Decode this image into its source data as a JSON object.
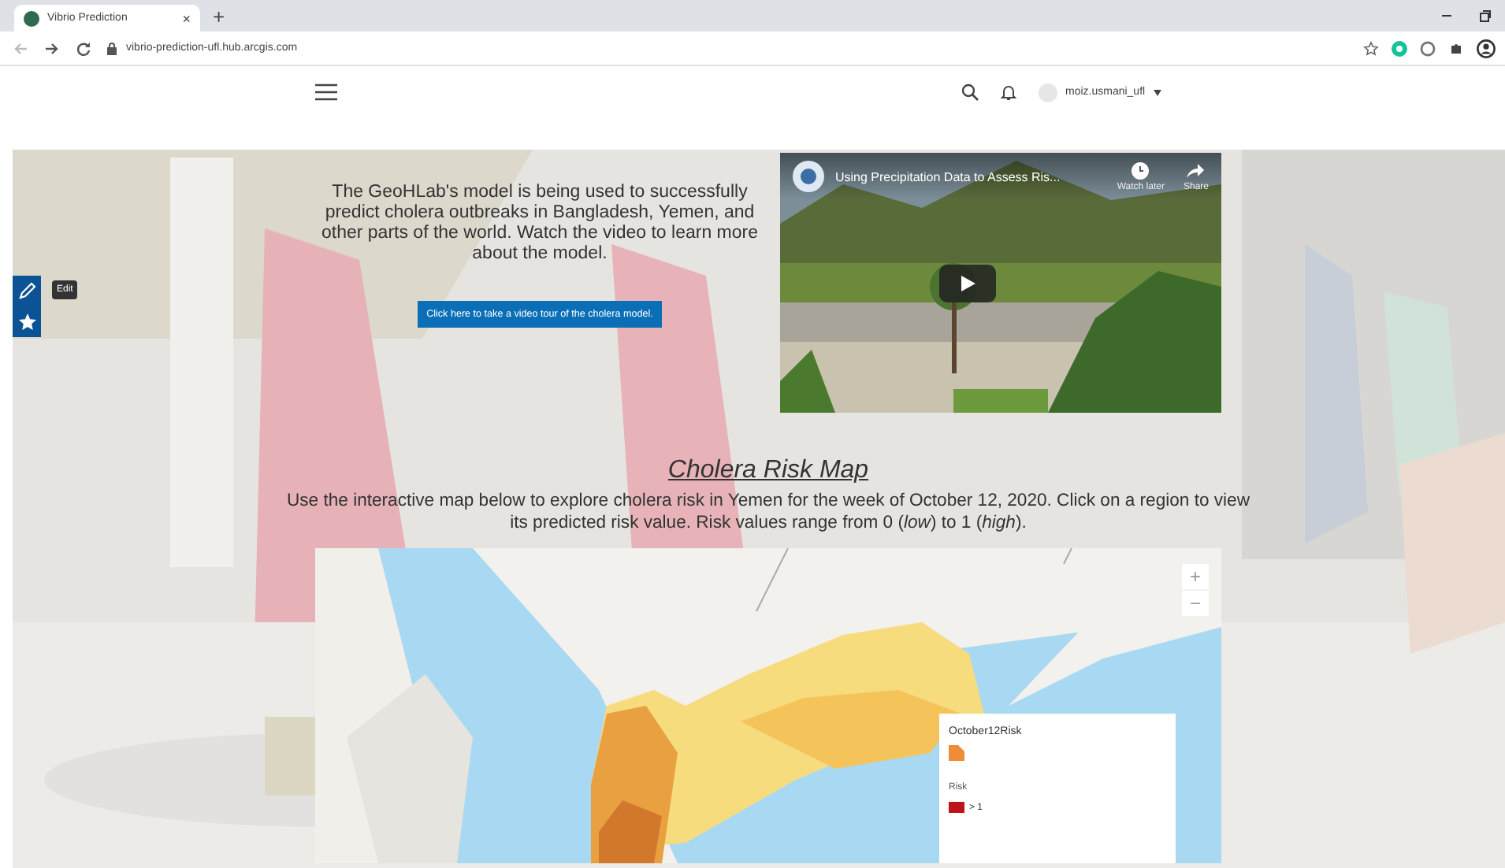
{
  "browser": {
    "tab": {
      "title": "Vibrio Prediction",
      "close": "×",
      "new_tab": "+"
    },
    "address": "vibrio-prediction-ufl.hub.arcgis.com"
  },
  "header": {
    "user": "moiz.usmani_ufl"
  },
  "side_toolbar": {
    "tooltip": "Edit"
  },
  "intro": {
    "text": "The GeoHLab's model is being used to successfully predict cholera outbreaks in Bangladesh, Yemen, and other parts of the world. Watch the video to learn more about the model.",
    "button": "Click here to take a video tour of the cholera model."
  },
  "video": {
    "title": "Using Precipitation Data to Assess Ris...",
    "actions": [
      {
        "kind": "clock",
        "label": "Watch later"
      },
      {
        "kind": "share",
        "label": "Share"
      }
    ]
  },
  "map_section": {
    "title": "Cholera Risk Map",
    "description": "Use the interactive map below to explore cholera risk in Yemen for the week of October 12, 2020. Click on a region to view its predicted risk value. Risk values range from 0 (*low*) to 1 (*high*).",
    "zoom": [
      "+",
      "−"
    ],
    "legend": {
      "title": "October12Risk",
      "field": "Risk",
      "classes": [
        {
          "label": "> 1"
        }
      ]
    }
  }
}
